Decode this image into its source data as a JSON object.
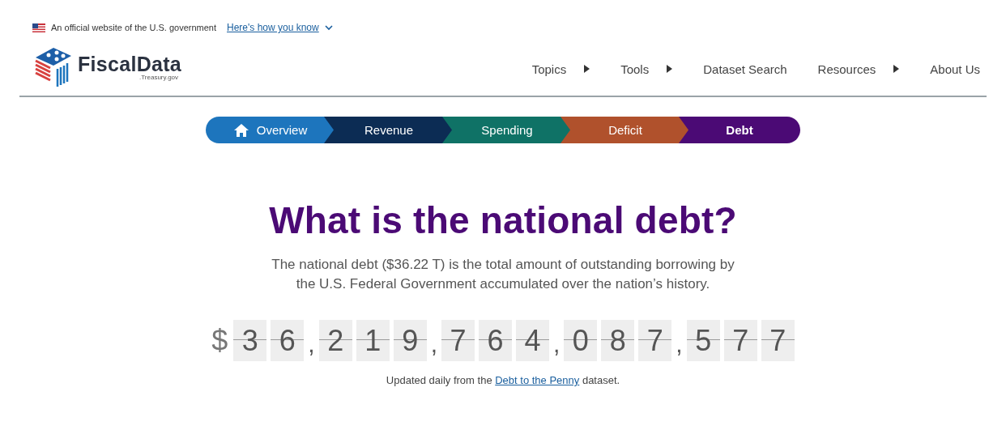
{
  "gov_banner": {
    "text": "An official website of the U.S. government",
    "link": "Here's how you know"
  },
  "logo": {
    "name": "FiscalData",
    "domain": ".Treasury.gov"
  },
  "nav": [
    {
      "label": "Topics",
      "kind": "menu"
    },
    {
      "label": "Tools",
      "kind": "menu"
    },
    {
      "label": "Dataset Search",
      "kind": "link"
    },
    {
      "label": "Resources",
      "kind": "menu"
    },
    {
      "label": "About Us",
      "kind": "link"
    }
  ],
  "tabs": [
    {
      "label": "Overview",
      "color": "#1d75bd",
      "selected": false
    },
    {
      "label": "Revenue",
      "color": "#0c2c54",
      "selected": false
    },
    {
      "label": "Spending",
      "color": "#0f7266",
      "selected": false
    },
    {
      "label": "Deficit",
      "color": "#b0512c",
      "selected": false
    },
    {
      "label": "Debt",
      "color": "#4b0a75",
      "selected": true
    }
  ],
  "heading": "What is the national debt?",
  "description": "The national debt ($36.22 T) is the total amount of outstanding borrowing by the U.S. Federal Government accumulated over the nation’s history.",
  "counter": [
    "$",
    "3",
    "6",
    ",",
    "2",
    "1",
    "9",
    ",",
    "7",
    "6",
    "4",
    ",",
    "0",
    "8",
    "7",
    ",",
    "5",
    "7",
    "7"
  ],
  "update_note": {
    "before": "Updated daily from the",
    "link": "Debt to the Penny",
    "after": "dataset."
  }
}
